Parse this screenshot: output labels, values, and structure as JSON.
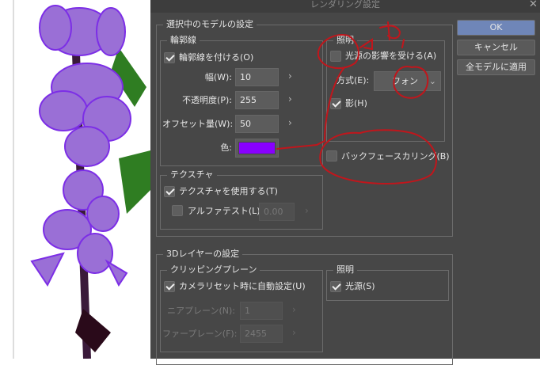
{
  "dialog": {
    "title": "レンダリング設定"
  },
  "buttons": {
    "ok": "OK",
    "cancel": "キャンセル",
    "apply_all": "全モデルに適用"
  },
  "model_settings": {
    "title": "選択中のモデルの設定",
    "outline": {
      "title": "輪郭線",
      "enable_label": "輪郭線を付ける(O)",
      "enable_checked": true,
      "width_label": "幅(W):",
      "width": "10",
      "opacity_label": "不透明度(P):",
      "opacity": "255",
      "offset_label": "オフセット量(W):",
      "offset": "50",
      "color_label": "色:",
      "color": "#8800ff"
    },
    "lighting": {
      "title": "照明",
      "affect_label": "光源の影響を受ける(A)",
      "affect_checked": false,
      "method_label": "方式(E):",
      "method": "フォン",
      "shadow_label": "影(H)",
      "shadow_checked": true
    },
    "backface_label": "バックフェースカリング(B)",
    "backface_checked": false,
    "texture": {
      "title": "テクスチャ",
      "use_label": "テクスチャを使用する(T)",
      "use_checked": true,
      "alpha_label": "アルファテスト(L)",
      "alpha_checked": false,
      "alpha_value": "0.00"
    }
  },
  "layer_settings": {
    "title": "3Dレイヤーの設定",
    "clipping": {
      "title": "クリッピングプレーン",
      "auto_label": "カメラリセット時に自動設定(U)",
      "auto_checked": true,
      "near_label": "ニアプレーン(N):",
      "near": "1",
      "far_label": "ファープレーン(F):",
      "far": "2455"
    },
    "lighting": {
      "title": "照明",
      "light_label": "光源(S)",
      "light_checked": true
    }
  },
  "colors": {
    "accent": "#6f86b8",
    "annotation": "#c0161c",
    "outline_color": "#8800ff"
  }
}
